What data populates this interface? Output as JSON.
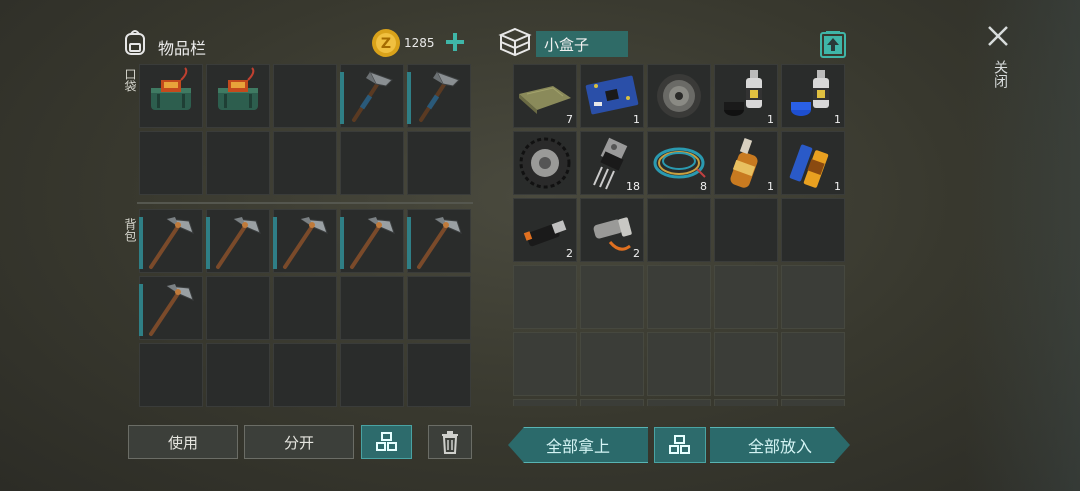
{
  "inventory": {
    "title": "物品栏",
    "coins": "1285",
    "pocket_label": "口袋",
    "backpack_label": "背包"
  },
  "container": {
    "name": "小盒子"
  },
  "close_label": "关闭",
  "buttons": {
    "use": "使用",
    "split": "分开",
    "take_all": "全部拿上",
    "put_all": "全部放入"
  },
  "pocket_slots": [
    {
      "item": "bomb-icon",
      "durability": false
    },
    {
      "item": "bomb-icon",
      "durability": false
    },
    {
      "item": "",
      "durability": false
    },
    {
      "item": "hatchet-icon",
      "durability": true
    },
    {
      "item": "hatchet-icon",
      "durability": true
    },
    {
      "item": ""
    },
    {
      "item": ""
    },
    {
      "item": ""
    },
    {
      "item": ""
    },
    {
      "item": ""
    }
  ],
  "backpack_slots": [
    {
      "item": "pickaxe-icon",
      "durability": true
    },
    {
      "item": "pickaxe-icon",
      "durability": true
    },
    {
      "item": "pickaxe-icon",
      "durability": true
    },
    {
      "item": "pickaxe-icon",
      "durability": true
    },
    {
      "item": "pickaxe-icon",
      "durability": true
    },
    {
      "item": "pickaxe-icon",
      "durability": true
    },
    {
      "item": ""
    },
    {
      "item": ""
    },
    {
      "item": ""
    },
    {
      "item": ""
    },
    {
      "item": ""
    },
    {
      "item": ""
    },
    {
      "item": ""
    },
    {
      "item": ""
    },
    {
      "item": ""
    }
  ],
  "box_slots": [
    {
      "item": "cloth-icon",
      "count": "7"
    },
    {
      "item": "circuit-board-icon",
      "count": "1"
    },
    {
      "item": "disc-icon",
      "count": ""
    },
    {
      "item": "spray-can-black-icon",
      "count": "1"
    },
    {
      "item": "spray-can-blue-icon",
      "count": "1"
    },
    {
      "item": "tire-icon",
      "count": ""
    },
    {
      "item": "transistor-icon",
      "count": "18"
    },
    {
      "item": "wire-icon",
      "count": "8"
    },
    {
      "item": "bottle-icon",
      "count": "1"
    },
    {
      "item": "batteries-icon",
      "count": "1"
    },
    {
      "item": "flash-drive-icon",
      "count": "2"
    },
    {
      "item": "flashlight-icon",
      "count": "2"
    }
  ]
}
